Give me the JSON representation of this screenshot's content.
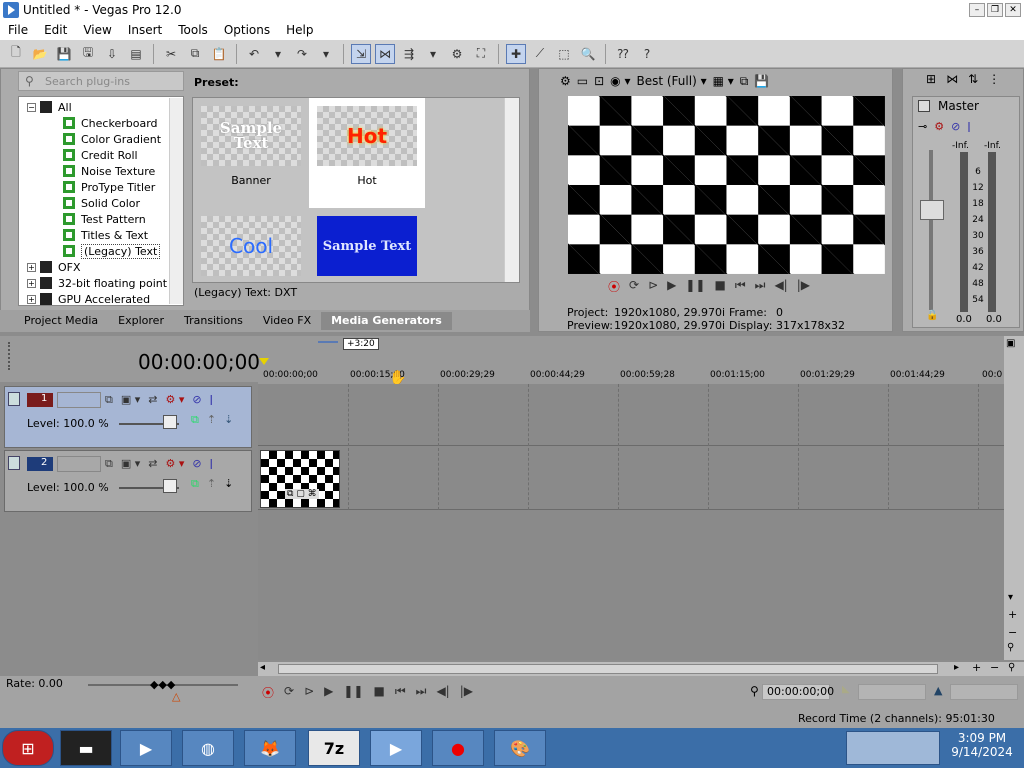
{
  "window": {
    "title": "Untitled * - Vegas Pro 12.0"
  },
  "menu": [
    "File",
    "Edit",
    "View",
    "Insert",
    "Tools",
    "Options",
    "Help"
  ],
  "explorer": {
    "search_placeholder": "Search plug-ins",
    "tree": [
      {
        "label": "All",
        "level": 0,
        "expanded": true,
        "folder": true
      },
      {
        "label": "Checkerboard",
        "level": 1
      },
      {
        "label": "Color Gradient",
        "level": 1
      },
      {
        "label": "Credit Roll",
        "level": 1
      },
      {
        "label": "Noise Texture",
        "level": 1
      },
      {
        "label": "ProType Titler",
        "level": 1
      },
      {
        "label": "Solid Color",
        "level": 1
      },
      {
        "label": "Test Pattern",
        "level": 1
      },
      {
        "label": "Titles & Text",
        "level": 1
      },
      {
        "label": "(Legacy) Text",
        "level": 1,
        "selected": true
      },
      {
        "label": "OFX",
        "level": 0,
        "folder": true
      },
      {
        "label": "32-bit floating point",
        "level": 0,
        "folder": true
      },
      {
        "label": "GPU Accelerated",
        "level": 0,
        "folder": true
      }
    ],
    "preset_label": "Preset:",
    "presets": [
      {
        "label": "Banner",
        "thumb_text": "Sample Text"
      },
      {
        "label": "Hot",
        "thumb_text": "Hot",
        "selected": true
      },
      {
        "label": "",
        "thumb_text": "Cool"
      },
      {
        "label": "",
        "thumb_text": "Sample Text"
      }
    ],
    "preset_description": "(Legacy) Text: DXT",
    "tabs": [
      "Project Media",
      "Explorer",
      "Transitions",
      "Video FX",
      "Media Generators"
    ],
    "active_tab": "Media Generators"
  },
  "preview": {
    "quality": "Best (Full)",
    "project_label": "Project:",
    "project_value": "1920x1080, 29.970i",
    "preview_label": "Preview:",
    "preview_value": "1920x1080, 29.970i",
    "frame_label": "Frame:",
    "frame_value": "0",
    "display_label": "Display:",
    "display_value": "317x178x32"
  },
  "master": {
    "title": "Master",
    "left_peak": "-Inf.",
    "right_peak": "-Inf.",
    "scale": [
      "6",
      "12",
      "18",
      "24",
      "30",
      "36",
      "42",
      "48",
      "54"
    ],
    "left_value": "0.0",
    "right_value": "0.0"
  },
  "timeline": {
    "timecode": "00:00:00;00",
    "marker_label": "+3:20",
    "ruler": [
      "00:00:00;00",
      "00:00:15;00",
      "00:00:29;29",
      "00:00:44;29",
      "00:00:59;28",
      "00:01:15;00",
      "00:01:29;29",
      "00:01:44;29",
      "00:0"
    ],
    "tracks": [
      {
        "number": "1",
        "level_label": "Level: 100.0 %",
        "selected": true
      },
      {
        "number": "2",
        "level_label": "Level: 100.0 %",
        "selected": false
      }
    ],
    "rate": "Rate: 0.00",
    "cursor_time": "00:00:00;00",
    "record_time": "Record Time (2 channels): 95:01:30"
  },
  "taskbar": {
    "time": "3:09 PM",
    "date": "9/14/2024",
    "apps": [
      "start",
      "terminal",
      "media-player",
      "world",
      "firefox",
      "7zip",
      "vegas",
      "recorder",
      "paint"
    ]
  },
  "colors": {
    "selected_track": "#a6b6d4",
    "taskbar": "#3b6ea8",
    "hot_text": "#ff2200",
    "cool_text": "#2b6cff",
    "blue_preset": "#0b1fd0"
  }
}
